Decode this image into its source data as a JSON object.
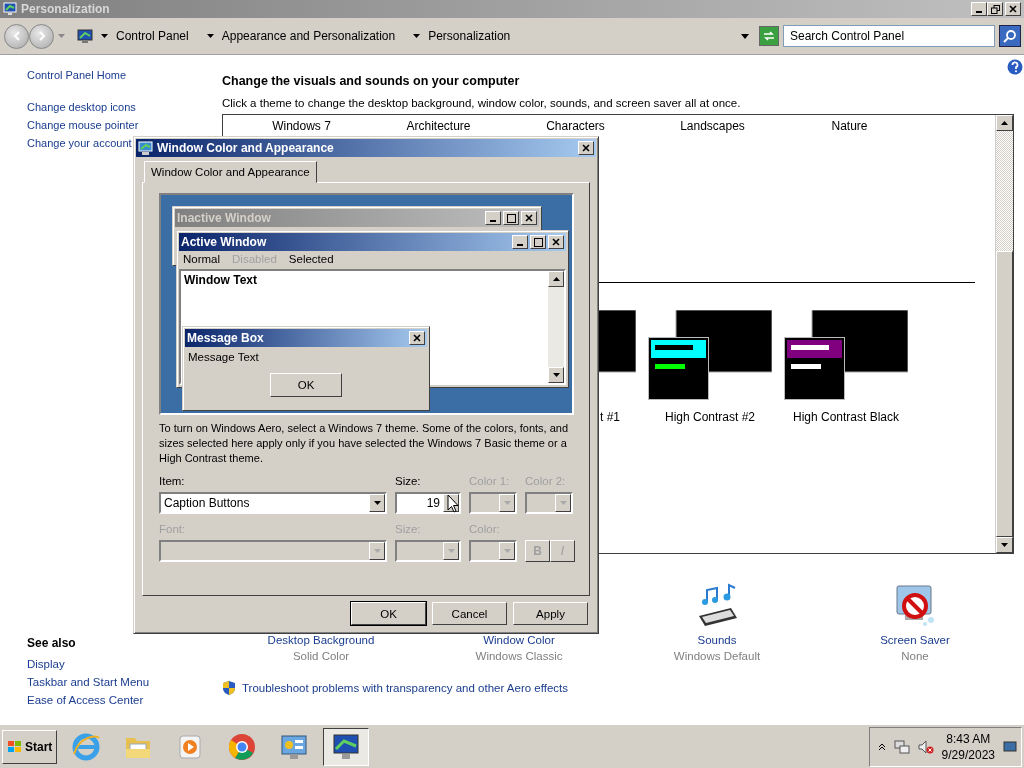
{
  "window": {
    "title": "Personalization"
  },
  "address_bar": {
    "crumbs": [
      "Control Panel",
      "Appearance and Personalization",
      "Personalization"
    ],
    "search_placeholder": "Search Control Panel"
  },
  "sidebar": {
    "links": [
      "Control Panel Home",
      "Change desktop icons",
      "Change mouse pointer",
      "Change your account"
    ],
    "see_also_title": "See also",
    "see_also": [
      "Display",
      "Taskbar and Start Menu",
      "Ease of Access Center"
    ]
  },
  "main": {
    "heading": "Change the visuals and sounds on your computer",
    "subheading": "Click a theme to change the desktop background, window color, sounds, and screen saver all at once."
  },
  "themes": {
    "aero": [
      "Windows 7",
      "Architecture",
      "Characters",
      "Landscapes",
      "Nature"
    ],
    "basic": [
      {
        "label": "t #1"
      },
      {
        "label": "High Contrast #2",
        "color": "#00ffff"
      },
      {
        "label": "High Contrast Black",
        "color": "#800080"
      }
    ]
  },
  "settings": [
    {
      "label": "Desktop Background",
      "value": "Solid Color"
    },
    {
      "label": "Window Color",
      "value": "Windows Classic"
    },
    {
      "label": "Sounds",
      "value": "Windows Default"
    },
    {
      "label": "Screen Saver",
      "value": "None"
    }
  ],
  "troubleshoot": "Troubleshoot problems with transparency and other Aero effects",
  "dialog": {
    "title": "Window Color and Appearance",
    "tabs": [
      {
        "label": "Window Color and Appearance",
        "selected": true
      }
    ],
    "preview": {
      "inactive_title": "Inactive Window",
      "active_title": "Active Window",
      "menu": [
        {
          "label": "Normal",
          "disabled": false
        },
        {
          "label": "Disabled",
          "disabled": true
        },
        {
          "label": "Selected",
          "disabled": false
        }
      ],
      "window_text": "Window Text",
      "message_box": {
        "title": "Message Box",
        "text": "Message Text",
        "button": "OK"
      }
    },
    "description": "To turn on Windows Aero, select a Windows 7 theme.  Some of the colors, fonts, and sizes selected here apply only if you have selected the Windows 7 Basic theme or a High Contrast theme.",
    "field_rows": [
      [
        {
          "kind": "dropdown",
          "label": "Item:",
          "value": "Caption Buttons",
          "disabled": false
        },
        {
          "kind": "spinner",
          "label": "Size:",
          "value": "19",
          "disabled": false
        },
        {
          "kind": "color",
          "label": "Color 1:",
          "disabled": true
        },
        {
          "kind": "color",
          "label": "Color 2:",
          "disabled": true
        }
      ],
      [
        {
          "kind": "dropdown",
          "label": "Font:",
          "disabled": true
        },
        {
          "kind": "dropdown",
          "label": "Size:",
          "disabled": true
        },
        {
          "kind": "color",
          "label": "Color:",
          "disabled": true
        },
        {
          "kind": "toggles",
          "buttons": [
            "B",
            "I"
          ],
          "disabled": true
        }
      ]
    ],
    "buttons": [
      "OK",
      "Cancel",
      "Apply"
    ]
  },
  "taskbar": {
    "start": "Start",
    "apps": [
      {
        "active": false
      },
      {
        "active": false
      },
      {
        "active": false
      },
      {
        "active": false
      },
      {
        "active": false
      },
      {
        "active": true
      }
    ],
    "time": "8:43 AM",
    "date": "9/29/2023"
  }
}
